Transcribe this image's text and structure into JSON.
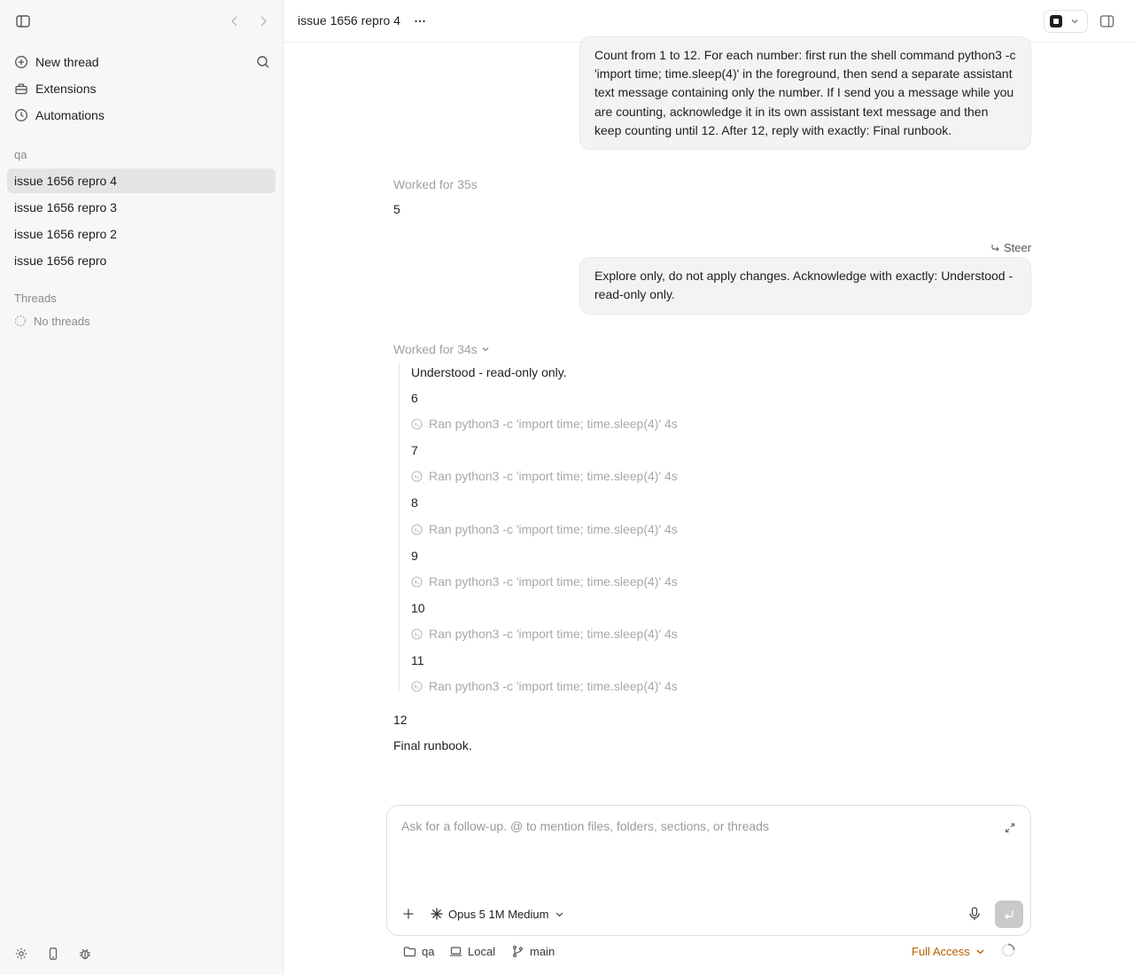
{
  "sidebar": {
    "nav": [
      {
        "label": "New thread",
        "icon": "plus-circle-icon"
      },
      {
        "label": "Extensions",
        "icon": "toolbox-icon"
      },
      {
        "label": "Automations",
        "icon": "clock-icon"
      }
    ],
    "project_label": "qa",
    "project_threads": [
      {
        "label": "issue 1656 repro 4",
        "active": true
      },
      {
        "label": "issue 1656 repro 3"
      },
      {
        "label": "issue 1656 repro 2"
      },
      {
        "label": "issue 1656 repro"
      }
    ],
    "threads_label": "Threads",
    "no_threads_label": "No threads"
  },
  "header": {
    "title": "issue 1656 repro 4"
  },
  "conversation": {
    "user_message_1": "Count from 1 to 12. For each number: first run the shell command python3 -c 'import time; time.sleep(4)' in the foreground, then send a separate assistant text message containing only the number. If I send you a message while you are counting, acknowledge it in its own assistant text message and then keep counting until 12. After 12, reply with exactly: Final runbook.",
    "worked_1": "Worked for 35s",
    "reply_1": "5",
    "steer_label": "Steer",
    "user_message_2": "Explore only, do not apply changes. Acknowledge with exactly: Understood - read-only only.",
    "worked_2": "Worked for 34s",
    "thread_ack": "Understood - read-only only.",
    "steps": [
      {
        "number": "6",
        "ran": "Ran python3 -c 'import time; time.sleep(4)' 4s"
      },
      {
        "number": "7",
        "ran": "Ran python3 -c 'import time; time.sleep(4)' 4s"
      },
      {
        "number": "8",
        "ran": "Ran python3 -c 'import time; time.sleep(4)' 4s"
      },
      {
        "number": "9",
        "ran": "Ran python3 -c 'import time; time.sleep(4)' 4s"
      },
      {
        "number": "10",
        "ran": "Ran python3 -c 'import time; time.sleep(4)' 4s"
      },
      {
        "number": "11",
        "ran": "Ran python3 -c 'import time; time.sleep(4)' 4s"
      }
    ],
    "final_number": "12",
    "final_text": "Final runbook."
  },
  "composer": {
    "placeholder": "Ask for a follow-up. @ to mention files, folders, sections, or threads",
    "value": "",
    "model_label": "Opus 5 1M Medium"
  },
  "footer": {
    "folder": "qa",
    "environment": "Local",
    "branch": "main",
    "access": "Full Access"
  },
  "colors": {
    "sidebar_bg": "#f7f7f7",
    "active_thread_bg": "#e4e4e4",
    "bubble_bg": "#f3f3f3",
    "access_color": "#b35f00",
    "muted_text": "#a0a0a0"
  }
}
